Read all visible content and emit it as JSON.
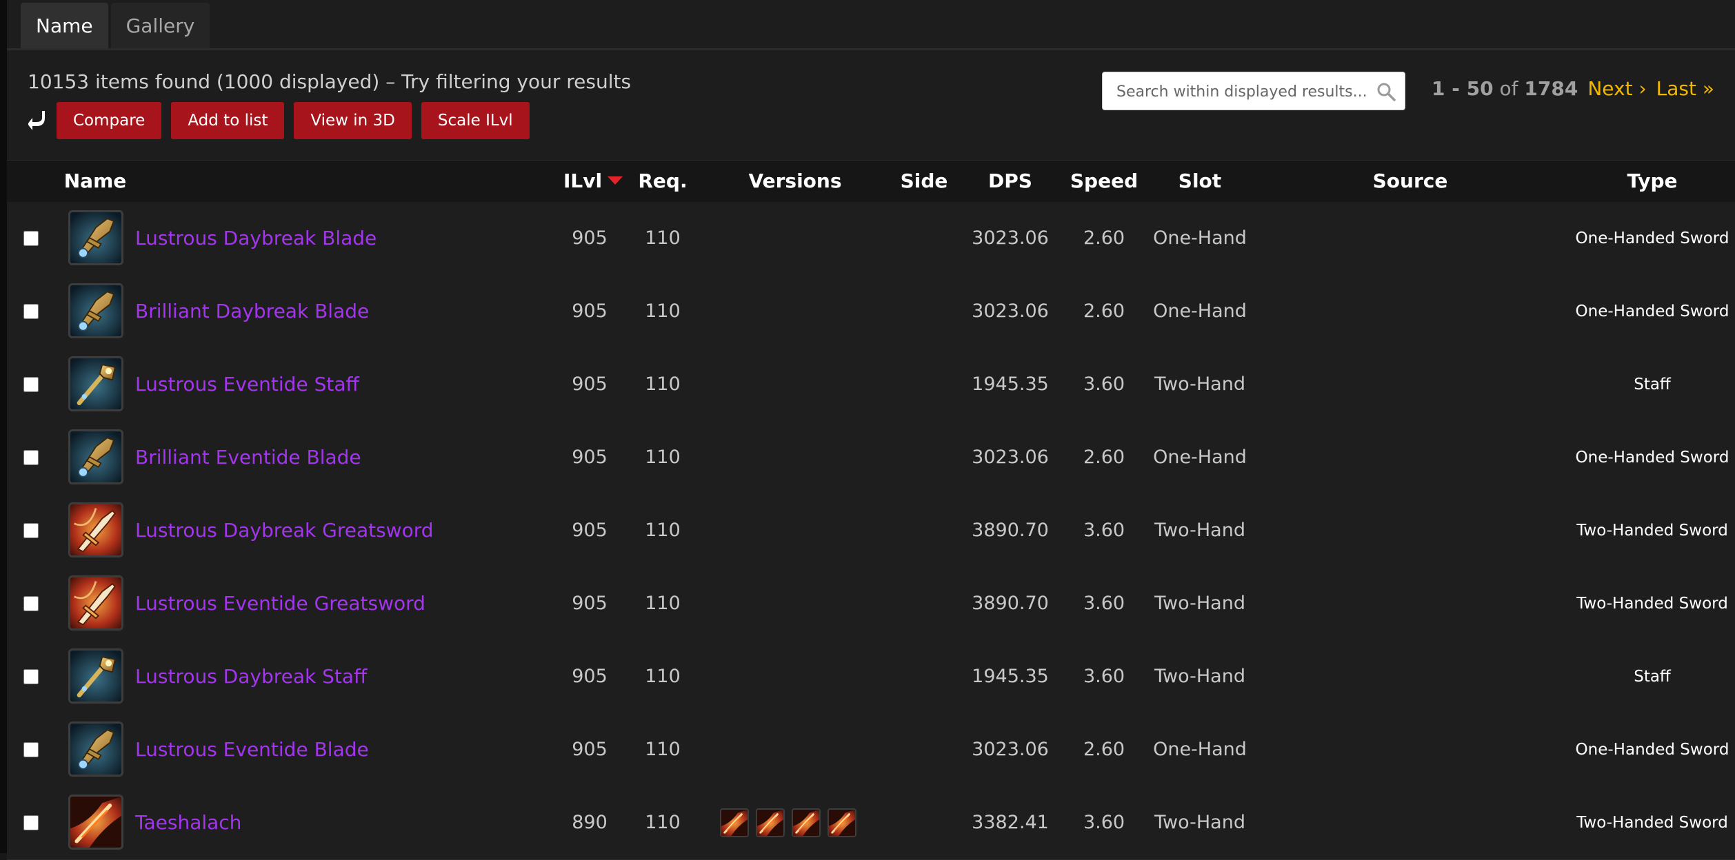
{
  "tabs": [
    {
      "label": "Name",
      "active": true
    },
    {
      "label": "Gallery",
      "active": false
    }
  ],
  "summary": "10153 items found (1000 displayed) – Try filtering your results",
  "actions": {
    "compare": "Compare",
    "add_to_list": "Add to list",
    "view_3d": "View in 3D",
    "scale_ilvl": "Scale ILvl"
  },
  "search": {
    "placeholder": "Search within displayed results..."
  },
  "pagination": {
    "range": "1 - 50",
    "of_text": "of",
    "total": "1784",
    "next": "Next ›",
    "last": "Last »"
  },
  "columns": {
    "name": "Name",
    "ilvl": "ILvl",
    "req": "Req.",
    "versions": "Versions",
    "side": "Side",
    "dps": "DPS",
    "speed": "Speed",
    "slot": "Slot",
    "source": "Source",
    "type": "Type"
  },
  "colors": {
    "item_quality_epic": "#a335ee",
    "button_red": "#a8141b",
    "pager_link": "#f2b800",
    "sort_caret": "#e0242a"
  },
  "rows": [
    {
      "name": "Lustrous Daybreak Blade",
      "icon": "sword-icon",
      "ilvl": "905",
      "req": "110",
      "versions": "",
      "side": "",
      "dps": "3023.06",
      "speed": "2.60",
      "slot": "One-Hand",
      "source": "",
      "type": "One-Handed Sword"
    },
    {
      "name": "Brilliant Daybreak Blade",
      "icon": "sword-icon",
      "ilvl": "905",
      "req": "110",
      "versions": "",
      "side": "",
      "dps": "3023.06",
      "speed": "2.60",
      "slot": "One-Hand",
      "source": "",
      "type": "One-Handed Sword"
    },
    {
      "name": "Lustrous Eventide Staff",
      "icon": "staff-icon",
      "ilvl": "905",
      "req": "110",
      "versions": "",
      "side": "",
      "dps": "1945.35",
      "speed": "3.60",
      "slot": "Two-Hand",
      "source": "",
      "type": "Staff"
    },
    {
      "name": "Brilliant Eventide Blade",
      "icon": "sword-icon",
      "ilvl": "905",
      "req": "110",
      "versions": "",
      "side": "",
      "dps": "3023.06",
      "speed": "2.60",
      "slot": "One-Hand",
      "source": "",
      "type": "One-Handed Sword"
    },
    {
      "name": "Lustrous Daybreak Greatsword",
      "icon": "greatsword-icon",
      "ilvl": "905",
      "req": "110",
      "versions": "",
      "side": "",
      "dps": "3890.70",
      "speed": "3.60",
      "slot": "Two-Hand",
      "source": "",
      "type": "Two-Handed Sword"
    },
    {
      "name": "Lustrous Eventide Greatsword",
      "icon": "greatsword-icon",
      "ilvl": "905",
      "req": "110",
      "versions": "",
      "side": "",
      "dps": "3890.70",
      "speed": "3.60",
      "slot": "Two-Hand",
      "source": "",
      "type": "Two-Handed Sword"
    },
    {
      "name": "Lustrous Daybreak Staff",
      "icon": "staff-icon",
      "ilvl": "905",
      "req": "110",
      "versions": "",
      "side": "",
      "dps": "1945.35",
      "speed": "3.60",
      "slot": "Two-Hand",
      "source": "",
      "type": "Staff"
    },
    {
      "name": "Lustrous Eventide Blade",
      "icon": "sword-icon",
      "ilvl": "905",
      "req": "110",
      "versions": "",
      "side": "",
      "dps": "3023.06",
      "speed": "2.60",
      "slot": "One-Hand",
      "source": "",
      "type": "One-Handed Sword"
    },
    {
      "name": "Taeshalach",
      "icon": "fire-sword-icon",
      "ilvl": "890",
      "req": "110",
      "versions": [
        "fire-sword-icon",
        "fire-sword-icon",
        "fire-sword-icon",
        "fire-sword-icon"
      ],
      "side": "",
      "dps": "3382.41",
      "speed": "3.60",
      "slot": "Two-Hand",
      "source": "",
      "type": "Two-Handed Sword"
    }
  ]
}
